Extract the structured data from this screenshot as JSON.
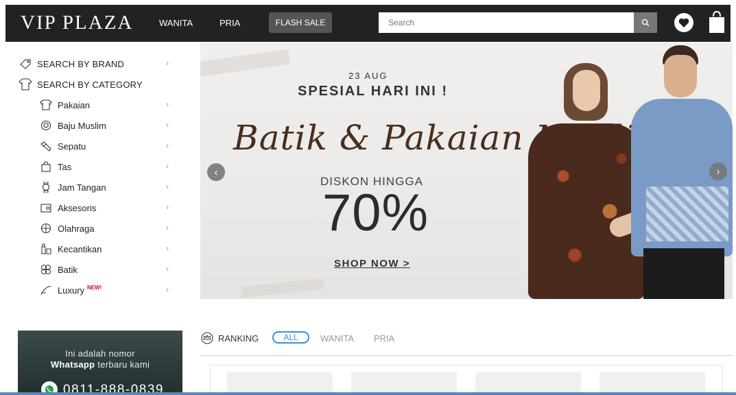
{
  "header": {
    "logo": "VIP PLAZA",
    "nav": [
      "WANITA",
      "PRIA"
    ],
    "flash_sale": "FLASH SALE",
    "search_placeholder": "Search"
  },
  "sidebar": {
    "search_by_brand": "SEARCH BY BRAND",
    "search_by_category": "SEARCH BY CATEGORY",
    "categories": [
      {
        "label": "Pakaian",
        "icon": "shirt-icon"
      },
      {
        "label": "Baju Muslim",
        "icon": "hijab-icon"
      },
      {
        "label": "Sepatu",
        "icon": "shoe-icon"
      },
      {
        "label": "Tas",
        "icon": "bag-icon"
      },
      {
        "label": "Jam Tangan",
        "icon": "watch-icon"
      },
      {
        "label": "Aksesoris",
        "icon": "wallet-icon"
      },
      {
        "label": "Olahraga",
        "icon": "ball-icon"
      },
      {
        "label": "Kecantikan",
        "icon": "cosmetics-icon"
      },
      {
        "label": "Batik",
        "icon": "batik-icon"
      },
      {
        "label": "Luxury",
        "icon": "luxury-icon",
        "badge": "NEW!"
      }
    ]
  },
  "banner": {
    "date": "23 AUG",
    "headline": "SPESIAL HARI INI !",
    "script": "Batik & Pakaian Muslim",
    "discount_label": "DISKON HINGGA",
    "discount_value": "70%",
    "cta": "SHOP NOW >"
  },
  "whatsapp": {
    "line1": "Ini adalah nomor",
    "line2_bold": "Whatsapp",
    "line2_rest": " terbaru kami",
    "phone": "0811-888-0839"
  },
  "ranking": {
    "title": "RANKING",
    "tabs": [
      "ALL",
      "WANITA",
      "PRIA"
    ],
    "active_tab": "ALL"
  },
  "colors": {
    "header_bg": "#222222",
    "accent": "#3a8dde",
    "new_badge": "#e0002a"
  }
}
